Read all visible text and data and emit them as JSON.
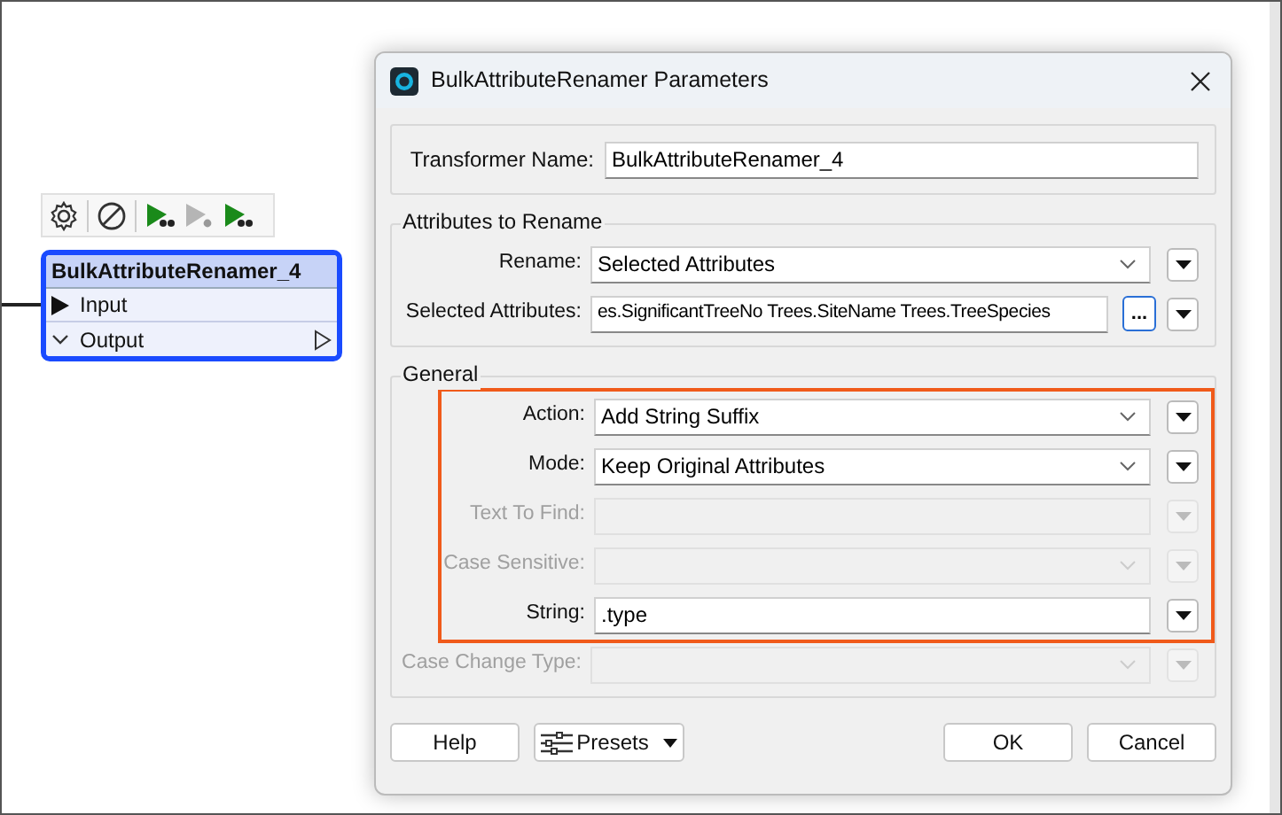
{
  "canvas": {
    "node": {
      "title": "BulkAttributeRenamer_4",
      "selected": true,
      "ports": [
        {
          "kind": "input",
          "label": "Input"
        },
        {
          "kind": "output",
          "label": "Output"
        }
      ]
    }
  },
  "dialog": {
    "title": "BulkAttributeRenamer Parameters",
    "transformer_name": {
      "label": "Transformer Name:",
      "value": "BulkAttributeRenamer_4"
    },
    "sections": [
      {
        "title": "Attributes to Rename",
        "rows": [
          {
            "kind": "dropdown",
            "label": "Rename:",
            "value": "Selected Attributes",
            "disabled": false,
            "highlighted": false
          },
          {
            "kind": "picker",
            "label": "Selected Attributes:",
            "value": "es.SignificantTreeNo Trees.SiteName Trees.TreeSpecies",
            "button": "...",
            "disabled": false,
            "highlighted": false
          }
        ]
      },
      {
        "title": "General",
        "rows": [
          {
            "kind": "dropdown",
            "label": "Action:",
            "value": "Add String Suffix",
            "disabled": false,
            "highlighted": true
          },
          {
            "kind": "dropdown",
            "label": "Mode:",
            "value": "Keep Original Attributes",
            "disabled": false,
            "highlighted": true
          },
          {
            "kind": "text",
            "label": "Text To Find:",
            "disabled": true,
            "highlighted": true
          },
          {
            "kind": "dropdown",
            "label": "Case Sensitive:",
            "disabled": true,
            "highlighted": true
          },
          {
            "kind": "text",
            "label": "String:",
            "value": ".type",
            "disabled": false,
            "highlighted": true
          },
          {
            "kind": "dropdown",
            "label": "Case Change Type:",
            "disabled": true,
            "highlighted": false
          }
        ]
      }
    ],
    "buttons": [
      {
        "kind": "plain",
        "label": "Help"
      },
      {
        "kind": "presets",
        "label": "Presets"
      },
      {
        "kind": "plain",
        "label": "OK"
      },
      {
        "kind": "plain",
        "label": "Cancel"
      }
    ]
  }
}
